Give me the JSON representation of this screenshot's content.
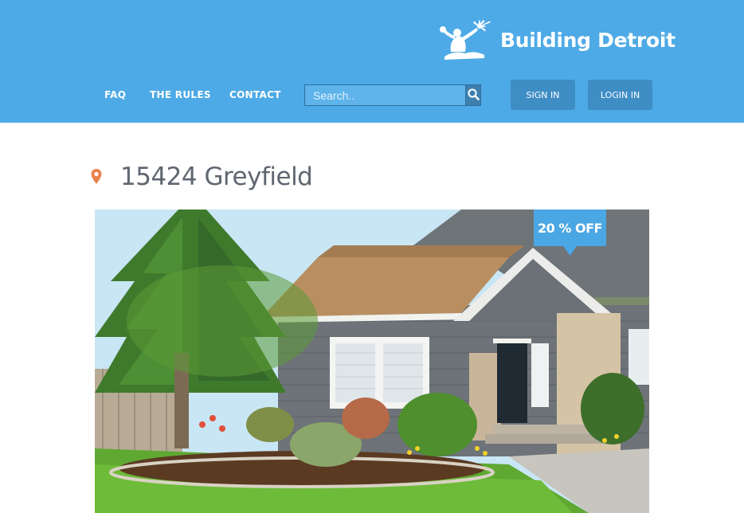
{
  "brand": {
    "name": "Building Detroit",
    "logo_icon": "spirit-of-detroit-statue-icon"
  },
  "nav": {
    "faq": "FAQ",
    "rules": "THE RULES",
    "contact": "CONTACT"
  },
  "search": {
    "placeholder": "Search..",
    "button_icon": "search-icon"
  },
  "auth": {
    "sign_in": "SIGN IN",
    "log_in": "LOGIN IN"
  },
  "listing": {
    "title": "15424 Greyfield",
    "location_icon": "map-pin-icon",
    "discount_badge": "20 % OFF"
  },
  "colors": {
    "header": "#4eaae6",
    "button": "#3e8dc5",
    "pin": "#e8834e",
    "badge": "#4ba7e3"
  }
}
